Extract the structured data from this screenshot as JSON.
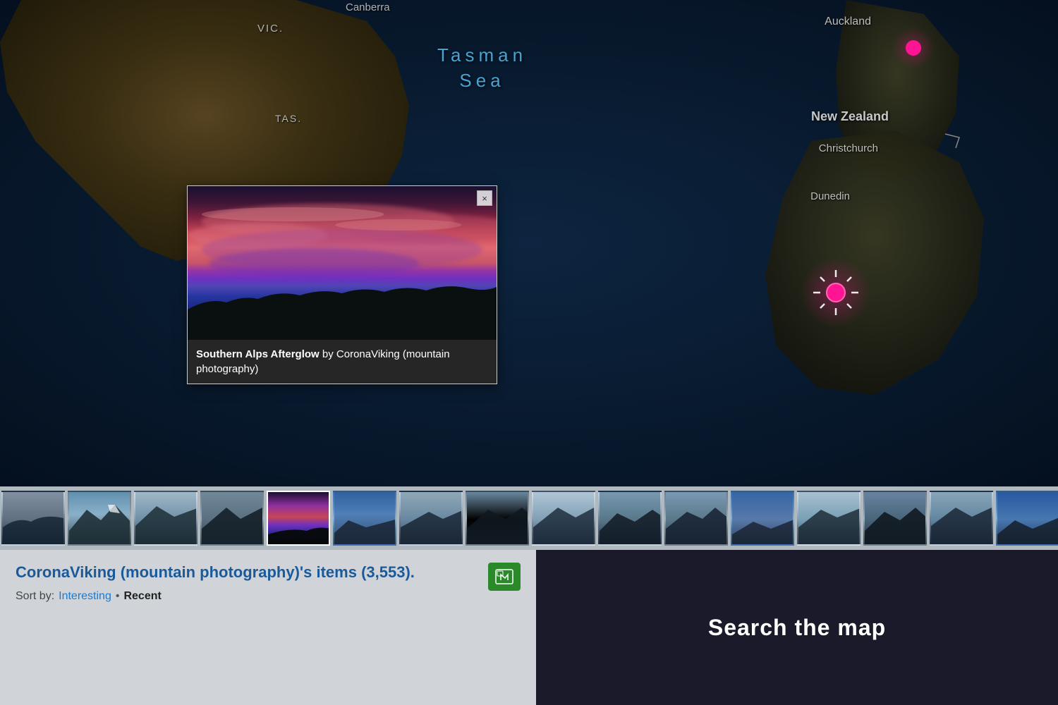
{
  "map": {
    "labels": {
      "canberra": "Canberra",
      "vic": "VIC.",
      "tas": "TAS.",
      "tasman_sea_line1": "Tasman",
      "tasman_sea_line2": "Sea",
      "auckland": "Auckland",
      "new_zealand": "New Zealand",
      "christchurch": "Christchurch",
      "dunedin": "Dunedin"
    }
  },
  "popup": {
    "close_label": "×",
    "photo_title": "Southern Alps Afterglow",
    "photo_author": "CoronaViking",
    "photo_group": "mountain photography",
    "caption_text": "Southern Alps Afterglow by CoronaViking (mountain photography)"
  },
  "filmstrip": {
    "thumbs": [
      {
        "type": "glacier",
        "active": false
      },
      {
        "type": "mountain",
        "active": false
      },
      {
        "type": "snow",
        "active": false
      },
      {
        "type": "mountain",
        "active": false
      },
      {
        "type": "sunset",
        "active": true
      },
      {
        "type": "sky",
        "active": false
      },
      {
        "type": "glacier",
        "active": false
      },
      {
        "type": "mountain",
        "active": false
      },
      {
        "type": "snow",
        "active": false
      },
      {
        "type": "glacier",
        "active": false
      },
      {
        "type": "mountain",
        "active": false
      },
      {
        "type": "sky",
        "active": false
      },
      {
        "type": "snow",
        "active": false
      },
      {
        "type": "mountain",
        "active": false
      },
      {
        "type": "glacier",
        "active": false
      },
      {
        "type": "sky",
        "active": false
      }
    ]
  },
  "bottom": {
    "left": {
      "title": "CoronaViking (mountain photography)'s items (3,553).",
      "sort_label": "Sort by:",
      "sort_interesting": "Interesting",
      "dot": "•",
      "sort_recent": "Recent"
    },
    "right": {
      "search_label": "Search the map"
    }
  }
}
